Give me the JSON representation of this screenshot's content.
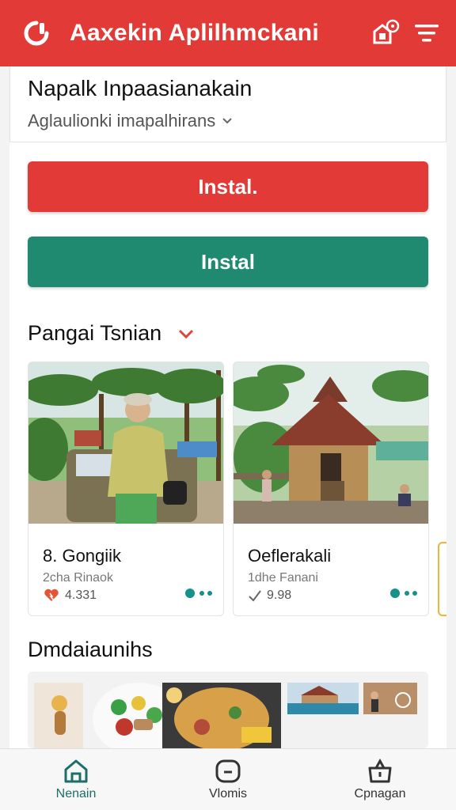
{
  "app": {
    "title": "Aaxekin  Aplilhmckani"
  },
  "header": {
    "title": "Napalk Inpaasianakain",
    "subtitle": "Aglaulionki imapalhirans"
  },
  "buttons": {
    "primary_label": "Instal.",
    "secondary_label": "Instal"
  },
  "sections": {
    "featured_title": "Pangai Tsnian",
    "food_title": "Dmdaiaunihs"
  },
  "cards": [
    {
      "title": "8. Gongiik",
      "subtitle": "2cha Rinaok",
      "meta": "4.331"
    },
    {
      "title": "Oeflerakali",
      "subtitle": "1dhe Fanani",
      "meta": "9.98"
    }
  ],
  "bottom_nav": [
    {
      "label": "Nenain",
      "icon": "home-icon",
      "active": true
    },
    {
      "label": "Vlomis",
      "icon": "message-icon",
      "active": false
    },
    {
      "label": "Cpnagan",
      "icon": "bag-icon",
      "active": false
    }
  ],
  "colors": {
    "brand_red": "#e23a37",
    "install_green": "#1f8a70",
    "accent_teal": "#16908a",
    "card_edge_orange": "#f0b23a"
  }
}
